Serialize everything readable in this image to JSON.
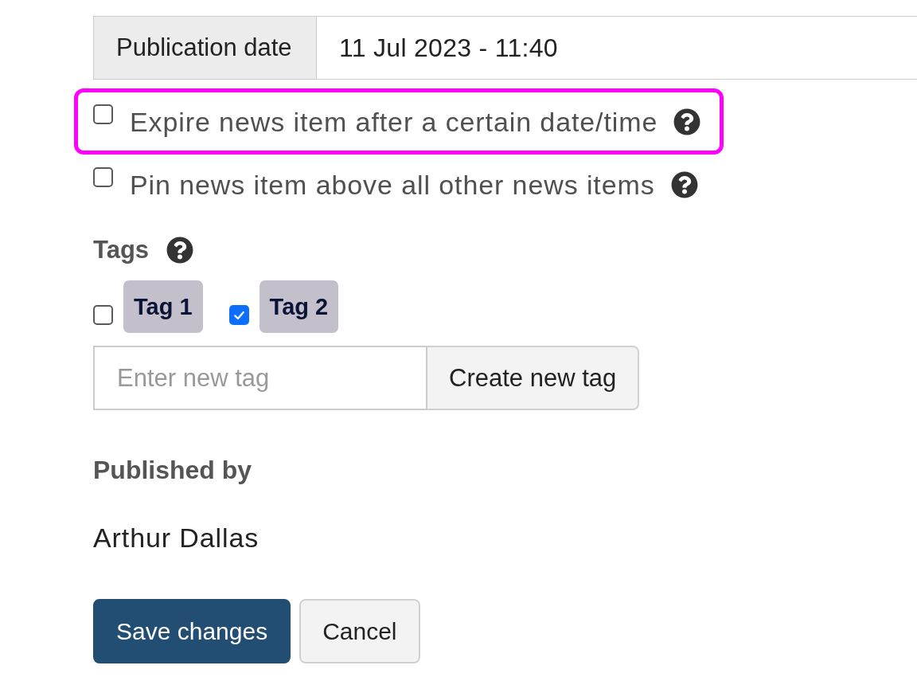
{
  "publication_date": {
    "label": "Publication date",
    "value": "11 Jul 2023 - 11:40"
  },
  "options": [
    {
      "label": "Expire news item after a certain date/time",
      "checked": false,
      "highlighted": true
    },
    {
      "label": "Pin news item above all other news items",
      "checked": false,
      "highlighted": false
    }
  ],
  "tags": {
    "heading": "Tags",
    "items": [
      {
        "label": "Tag 1",
        "checked": false
      },
      {
        "label": "Tag 2",
        "checked": true
      }
    ],
    "new_tag": {
      "placeholder": "Enter new tag",
      "button": "Create new tag"
    }
  },
  "published_by": {
    "heading": "Published by",
    "value": "Arthur Dallas"
  },
  "buttons": [
    {
      "label": "Save changes",
      "kind": "primary"
    },
    {
      "label": "Cancel",
      "kind": "secondary"
    }
  ]
}
